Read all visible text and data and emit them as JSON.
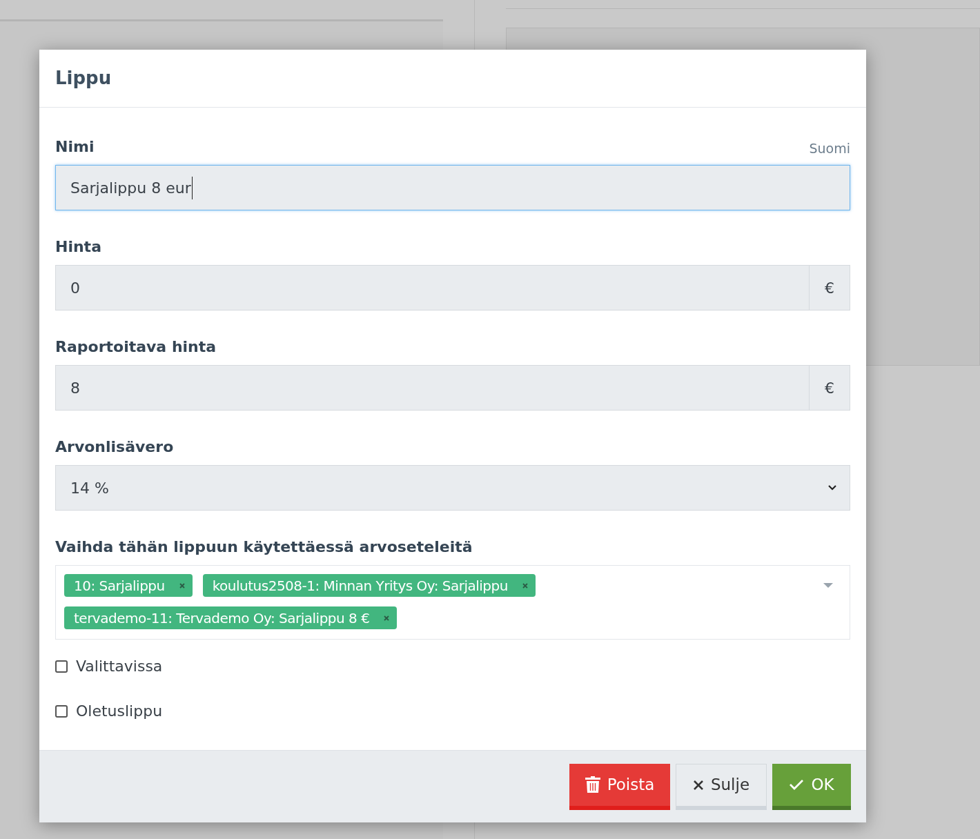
{
  "dialog": {
    "title": "Lippu"
  },
  "fields": [
    {
      "kind": "text",
      "label": "Nimi",
      "language": "Suomi",
      "value": "Sarjalippu 8 eur",
      "focused": true
    },
    {
      "kind": "addon",
      "label": "Hinta",
      "value": "0",
      "addon": "€",
      "focused": false
    },
    {
      "kind": "addon",
      "label": "Raportoitava hinta",
      "value": "8",
      "addon": "€",
      "focused": false
    },
    {
      "kind": "select",
      "label": "Arvonlisävero",
      "value": "14 %",
      "focused": false
    },
    {
      "kind": "tags",
      "label": "Vaihda tähän lippuun käytettäessä arvoseteleitä",
      "tags": [
        "10: Sarjalippu",
        "koulutus2508-1: Minnan Yritys Oy: Sarjalippu",
        "tervademo-11: Tervademo Oy: Sarjalippu 8 €"
      ]
    }
  ],
  "checkboxes": [
    {
      "label": "Valittavissa",
      "checked": false
    },
    {
      "label": "Oletuslippu",
      "checked": false
    }
  ],
  "buttons": [
    {
      "kind": "danger",
      "label": "Poista"
    },
    {
      "kind": "secondary",
      "label": "Sulje"
    },
    {
      "kind": "primary",
      "label": "OK"
    }
  ]
}
